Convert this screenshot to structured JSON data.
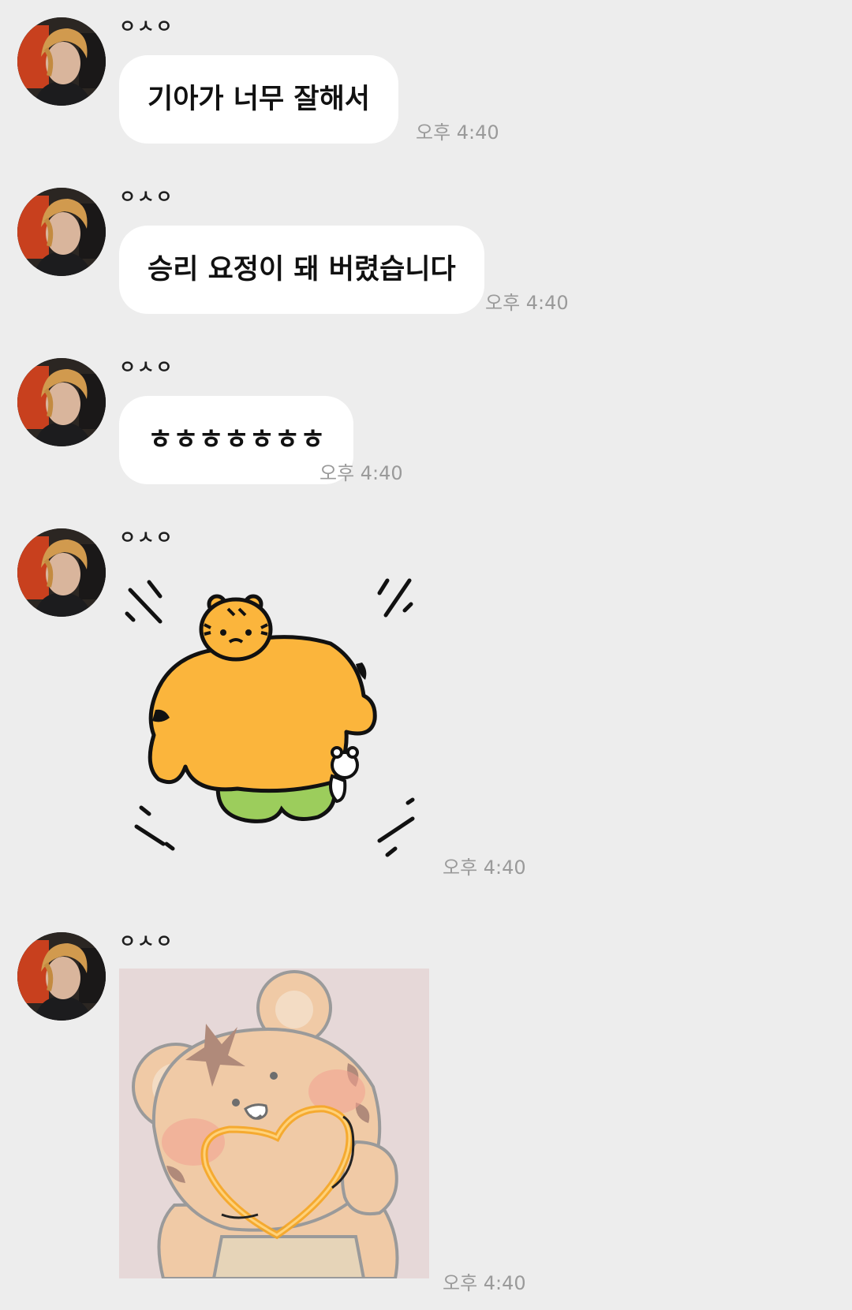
{
  "chat": {
    "messages": [
      {
        "sender": "ㅇㅅㅇ",
        "type": "text",
        "text": "기아가 너무 잘해서",
        "time": "오후 4:40"
      },
      {
        "sender": "ㅇㅅㅇ",
        "type": "text",
        "text": "승리 요정이 돼 버렸습니다",
        "time": "오후 4:40"
      },
      {
        "sender": "ㅇㅅㅇ",
        "type": "text",
        "text": "ㅎㅎㅎㅎㅎㅎㅎ",
        "time": "오후 4:40"
      },
      {
        "sender": "ㅇㅅㅇ",
        "type": "sticker",
        "sticker": "muscular-tiger-sticker",
        "time": "오후 4:40"
      },
      {
        "sender": "ㅇㅅㅇ",
        "type": "sticker",
        "sticker": "tiger-heart-sticker",
        "time": "오후 4:40"
      }
    ]
  },
  "colors": {
    "background": "#ededed",
    "bubble": "#ffffff",
    "timestamp": "#9a9a9a",
    "tiger_orange": "#fbb53c",
    "tiger_green_pants": "#9ccd5c",
    "sticker_pink_bg": "#e6d8d8"
  }
}
